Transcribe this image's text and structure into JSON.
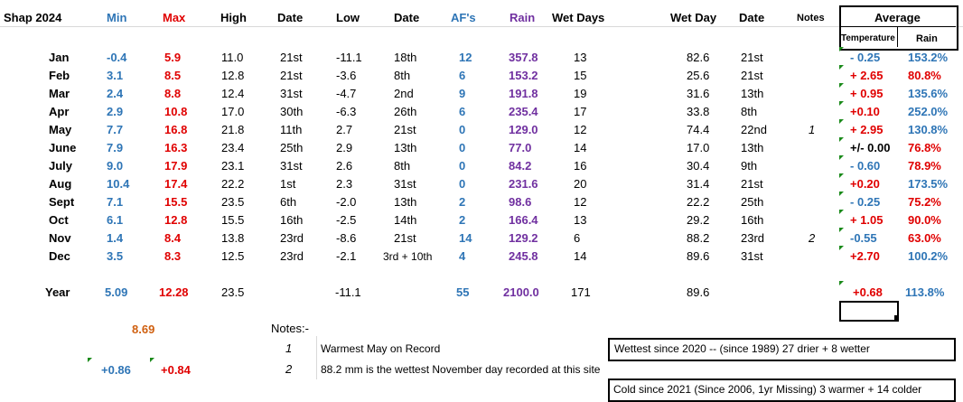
{
  "title": "Shap 2024",
  "headers": {
    "min": "Min",
    "max": "Max",
    "high": "High",
    "date1": "Date",
    "low": "Low",
    "date2": "Date",
    "afs": "AF's",
    "rain": "Rain",
    "wet_days": "Wet Days",
    "wet_day": "Wet Day",
    "date3": "Date",
    "notes": "Notes",
    "average": "Average",
    "temperature": "Temperature",
    "rain2": "Rain"
  },
  "months": [
    {
      "name": "Jan",
      "min": "-0.4",
      "max": "5.9",
      "high": "11.0",
      "high_date": "21st",
      "low": "-11.1",
      "low_date": "18th",
      "afs": "12",
      "rain": "357.8",
      "wet_days": "13",
      "wet_day": "82.6",
      "wet_date": "21st",
      "note": "",
      "avg_temp": "- 0.25",
      "avg_rain": "153.2%"
    },
    {
      "name": "Feb",
      "min": "3.1",
      "max": "8.5",
      "high": "12.8",
      "high_date": "21st",
      "low": "-3.6",
      "low_date": "8th",
      "afs": "6",
      "rain": "153.2",
      "wet_days": "15",
      "wet_day": "25.6",
      "wet_date": "21st",
      "note": "",
      "avg_temp": "+ 2.65",
      "avg_rain": "80.8%"
    },
    {
      "name": "Mar",
      "min": "2.4",
      "max": "8.8",
      "high": "12.4",
      "high_date": "31st",
      "low": "-4.7",
      "low_date": "2nd",
      "afs": "9",
      "rain": "191.8",
      "wet_days": "19",
      "wet_day": "31.6",
      "wet_date": "13th",
      "note": "",
      "avg_temp": "+ 0.95",
      "avg_rain": "135.6%"
    },
    {
      "name": "Apr",
      "min": "2.9",
      "max": "10.8",
      "high": "17.0",
      "high_date": "30th",
      "low": "-6.3",
      "low_date": "26th",
      "afs": "6",
      "rain": "235.4",
      "wet_days": "17",
      "wet_day": "33.8",
      "wet_date": "8th",
      "note": "",
      "avg_temp": "+0.10",
      "avg_rain": "252.0%"
    },
    {
      "name": "May",
      "min": "7.7",
      "max": "16.8",
      "high": "21.8",
      "high_date": "11th",
      "low": "2.7",
      "low_date": "21st",
      "afs": "0",
      "rain": "129.0",
      "wet_days": "12",
      "wet_day": "74.4",
      "wet_date": "22nd",
      "note": "1",
      "avg_temp": "+ 2.95",
      "avg_rain": "130.8%"
    },
    {
      "name": "June",
      "min": "7.9",
      "max": "16.3",
      "high": "23.4",
      "high_date": "25th",
      "low": "2.9",
      "low_date": "13th",
      "afs": "0",
      "rain": "77.0",
      "wet_days": "14",
      "wet_day": "17.0",
      "wet_date": "13th",
      "note": "",
      "avg_temp": "+/- 0.00",
      "avg_rain": "76.8%"
    },
    {
      "name": "July",
      "min": "9.0",
      "max": "17.9",
      "high": "23.1",
      "high_date": "31st",
      "low": "2.6",
      "low_date": "8th",
      "afs": "0",
      "rain": "84.2",
      "wet_days": "16",
      "wet_day": "30.4",
      "wet_date": "9th",
      "note": "",
      "avg_temp": "- 0.60",
      "avg_rain": "78.9%"
    },
    {
      "name": "Aug",
      "min": "10.4",
      "max": "17.4",
      "high": "22.2",
      "high_date": "1st",
      "low": "2.3",
      "low_date": "31st",
      "afs": "0",
      "rain": "231.6",
      "wet_days": "20",
      "wet_day": "31.4",
      "wet_date": "21st",
      "note": "",
      "avg_temp": "+0.20",
      "avg_rain": "173.5%"
    },
    {
      "name": "Sept",
      "min": "7.1",
      "max": "15.5",
      "high": "23.5",
      "high_date": "6th",
      "low": "-2.0",
      "low_date": "13th",
      "afs": "2",
      "rain": "98.6",
      "wet_days": "12",
      "wet_day": "22.2",
      "wet_date": "25th",
      "note": "",
      "avg_temp": "- 0.25",
      "avg_rain": "75.2%"
    },
    {
      "name": "Oct",
      "min": "6.1",
      "max": "12.8",
      "high": "15.5",
      "high_date": "16th",
      "low": "-2.5",
      "low_date": "14th",
      "afs": "2",
      "rain": "166.4",
      "wet_days": "13",
      "wet_day": "29.2",
      "wet_date": "16th",
      "note": "",
      "avg_temp": "+ 1.05",
      "avg_rain": "90.0%"
    },
    {
      "name": "Nov",
      "min": "1.4",
      "max": "8.4",
      "high": "13.8",
      "high_date": "23rd",
      "low": "-8.6",
      "low_date": "21st",
      "afs": "14",
      "rain": "129.2",
      "wet_days": "6",
      "wet_day": "88.2",
      "wet_date": "23rd",
      "note": "2",
      "avg_temp": "-0.55",
      "avg_rain": "63.0%"
    },
    {
      "name": "Dec",
      "min": "3.5",
      "max": "8.3",
      "high": "12.5",
      "high_date": "23rd",
      "low": "-2.1",
      "low_date": "3rd + 10th",
      "afs": "4",
      "rain": "245.8",
      "wet_days": "14",
      "wet_day": "89.6",
      "wet_date": "31st",
      "note": "",
      "avg_temp": "+2.70",
      "avg_rain": "100.2%"
    }
  ],
  "year": {
    "label": "Year",
    "min": "5.09",
    "max": "12.28",
    "high": "23.5",
    "low": "-11.1",
    "afs": "55",
    "rain": "2100.0",
    "wet_days": "171",
    "wet_day": "89.6",
    "avg_temp": "+0.68",
    "avg_rain": "113.8%"
  },
  "mean_value": "8.69",
  "min_anomaly": "+0.86",
  "max_anomaly": "+0.84",
  "notes": {
    "label": "Notes:-",
    "items": [
      {
        "num": "1",
        "text": "Warmest May on Record"
      },
      {
        "num": "2",
        "text": "88.2 mm is the wettest November  day recorded at this site"
      }
    ]
  },
  "wettest_box": "Wettest since 2020  --  (since 1989) 27 drier + 8 wetter",
  "cold_box": "Cold since 2021  (Since 2006, 1yr Missing)  3 warmer + 14 colder",
  "colors": {
    "blue": "#2e75b6",
    "red": "#e00000",
    "purple": "#7030a0",
    "orange": "#d06010",
    "green_marker": "#1a8a1a"
  }
}
